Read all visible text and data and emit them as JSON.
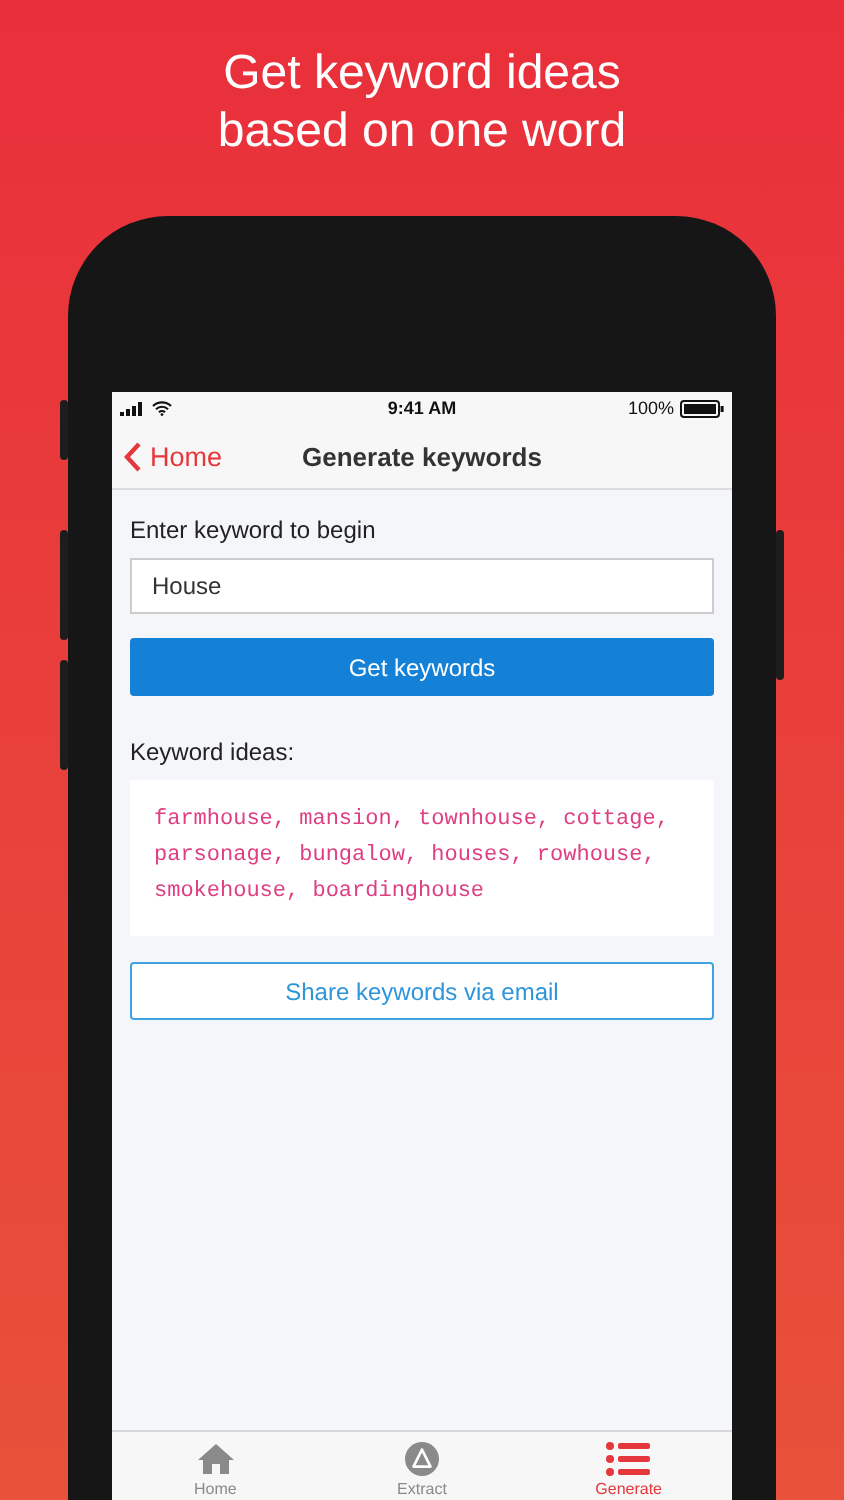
{
  "headline": [
    "Get keyword ideas",
    "based on one word"
  ],
  "status_bar": {
    "time": "9:41 AM",
    "battery": "100%"
  },
  "nav_bar": {
    "back": "Home",
    "title": "Generate keywords"
  },
  "form": {
    "label": "Enter keyword to begin",
    "value": "House",
    "button": "Get keywords"
  },
  "results": {
    "label": "Keyword ideas:",
    "keywords": "farmhouse, mansion, townhouse, cottage, parsonage, bungalow, houses, rowhouse, smokehouse, boardinghouse",
    "share_button": "Share keywords via email"
  },
  "tab_bar": [
    {
      "kind": "home",
      "label": "Home",
      "selected": false
    },
    {
      "kind": "extract",
      "label": "Extract",
      "selected": false
    },
    {
      "kind": "generate",
      "label": "Generate",
      "selected": true
    }
  ]
}
